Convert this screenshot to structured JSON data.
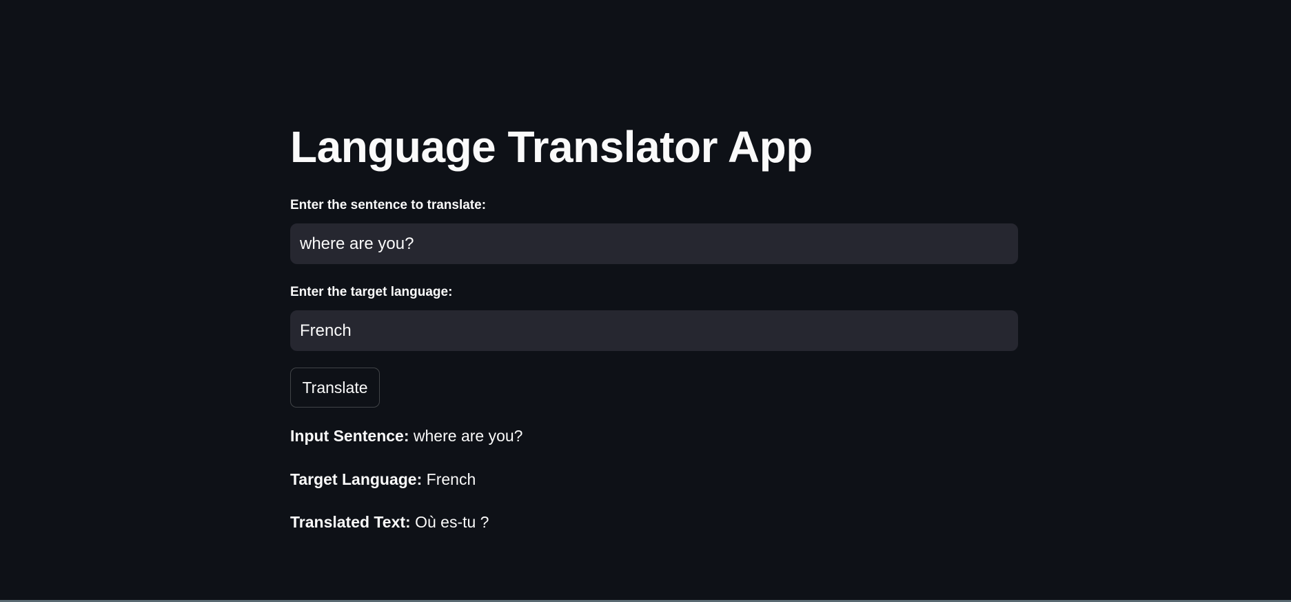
{
  "app": {
    "title": "Language Translator App"
  },
  "sentence_field": {
    "label": "Enter the sentence to translate:",
    "value": "where are you?"
  },
  "language_field": {
    "label": "Enter the target language:",
    "value": "French"
  },
  "translate_button": {
    "label": "Translate"
  },
  "results": {
    "input_sentence_label": "Input Sentence:",
    "input_sentence_value": "where are you?",
    "target_language_label": "Target Language:",
    "target_language_value": "French",
    "translated_text_label": "Translated Text:",
    "translated_text_value": "Où es-tu ?"
  },
  "colors": {
    "background": "#0e1117",
    "input_background": "#262730",
    "text": "#fafafa"
  }
}
